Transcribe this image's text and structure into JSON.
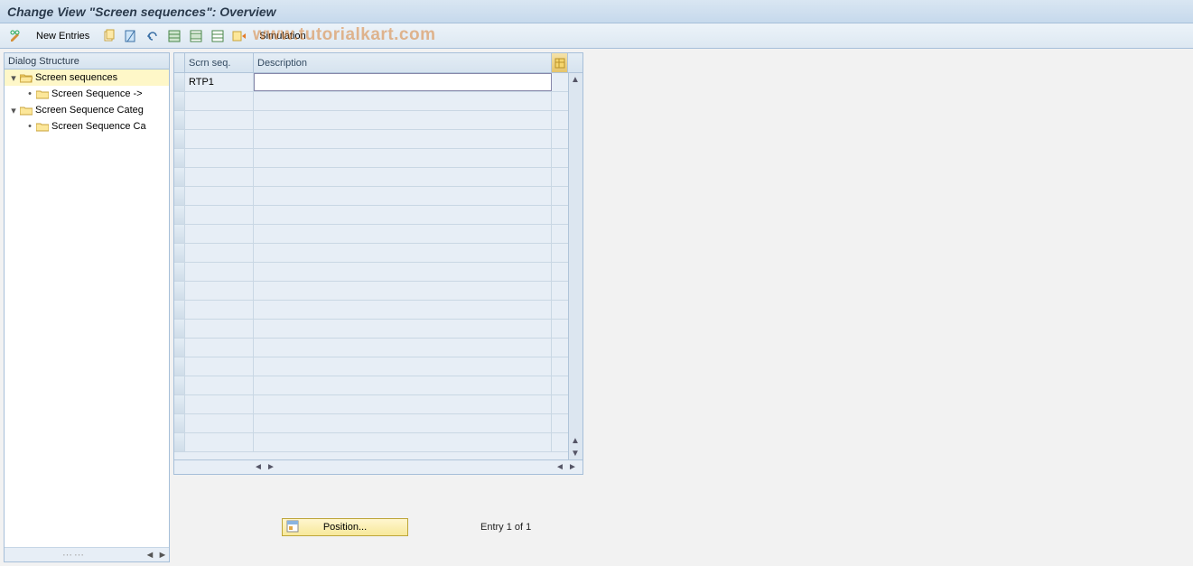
{
  "titlebar": {
    "title": "Change View \"Screen sequences\": Overview"
  },
  "toolbar": {
    "new_entries": "New Entries",
    "simulation": "Simulation"
  },
  "watermark": "www.tutorialkart.com",
  "tree": {
    "header": "Dialog Structure",
    "items": [
      {
        "label": "Screen sequences",
        "indent": 0,
        "expander": "▾",
        "open": true,
        "selected": true
      },
      {
        "label": "Screen Sequence ->",
        "indent": 1,
        "expander": "•",
        "open": false,
        "selected": false
      },
      {
        "label": "Screen Sequence Categ",
        "indent": 0,
        "expander": "▾",
        "open": false,
        "selected": false
      },
      {
        "label": "Screen Sequence Ca",
        "indent": 1,
        "expander": "•",
        "open": false,
        "selected": false
      }
    ]
  },
  "table": {
    "headers": {
      "seq": "Scrn seq.",
      "desc": "Description"
    },
    "rows": [
      {
        "seq": "RTP1",
        "desc": ""
      }
    ],
    "empty_row_count": 19
  },
  "bottom": {
    "position_button": "Position...",
    "status": "Entry 1 of 1"
  }
}
